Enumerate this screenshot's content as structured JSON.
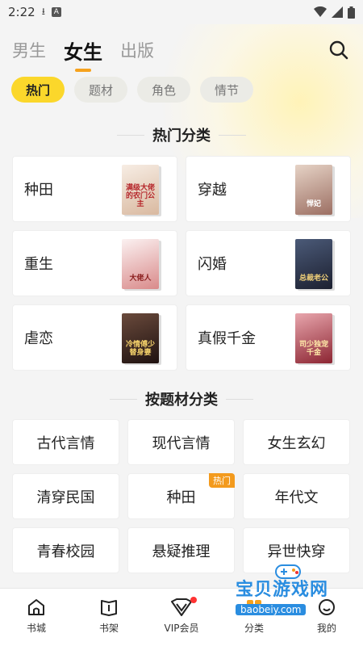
{
  "status_bar": {
    "time": "2:22"
  },
  "top_nav": {
    "tabs": [
      {
        "label": "男生"
      },
      {
        "label": "女生"
      },
      {
        "label": "出版"
      }
    ],
    "active_tab": "女生"
  },
  "filter_chips": [
    {
      "label": "热门"
    },
    {
      "label": "题材"
    },
    {
      "label": "角色"
    },
    {
      "label": "情节"
    }
  ],
  "hot_section": {
    "title": "热门分类",
    "items": [
      {
        "label": "种田",
        "cover_text": "满级大佬的农门公主",
        "cover_color": "#e8d8c8"
      },
      {
        "label": "穿越",
        "cover_text": "悍妃",
        "cover_color": "#c9b0a4"
      },
      {
        "label": "重生",
        "cover_text": "大佬人",
        "cover_color": "#f0e2e2"
      },
      {
        "label": "闪婚",
        "cover_text": "总裁老公",
        "cover_color": "#2d3550"
      },
      {
        "label": "虐恋",
        "cover_text": "冷情傅少替身妻",
        "cover_color": "#3a2320"
      },
      {
        "label": "真假千金",
        "cover_text": "司少独宠千金",
        "cover_color": "#b3434e"
      }
    ]
  },
  "theme_section": {
    "title": "按题材分类",
    "items": [
      {
        "label": "古代言情",
        "tag": ""
      },
      {
        "label": "现代言情",
        "tag": ""
      },
      {
        "label": "女生玄幻",
        "tag": ""
      },
      {
        "label": "清穿民国",
        "tag": ""
      },
      {
        "label": "种田",
        "tag": "热门"
      },
      {
        "label": "年代文",
        "tag": ""
      },
      {
        "label": "青春校园",
        "tag": ""
      },
      {
        "label": "悬疑推理",
        "tag": ""
      },
      {
        "label": "异世快穿",
        "tag": ""
      }
    ]
  },
  "bottom_nav": [
    {
      "label": "书城",
      "icon": "home-icon"
    },
    {
      "label": "书架",
      "icon": "bookshelf-icon"
    },
    {
      "label": "VIP会员",
      "icon": "vip-icon"
    },
    {
      "label": "分类",
      "icon": "category-icon"
    },
    {
      "label": "我的",
      "icon": "profile-icon"
    }
  ],
  "watermark": {
    "text": "宝贝游戏网",
    "url": "baobeiy.com"
  },
  "colors": {
    "accent": "#fbd72b",
    "tab_indicator": "#f6a21e",
    "hot_tag": "#f39a1d"
  }
}
